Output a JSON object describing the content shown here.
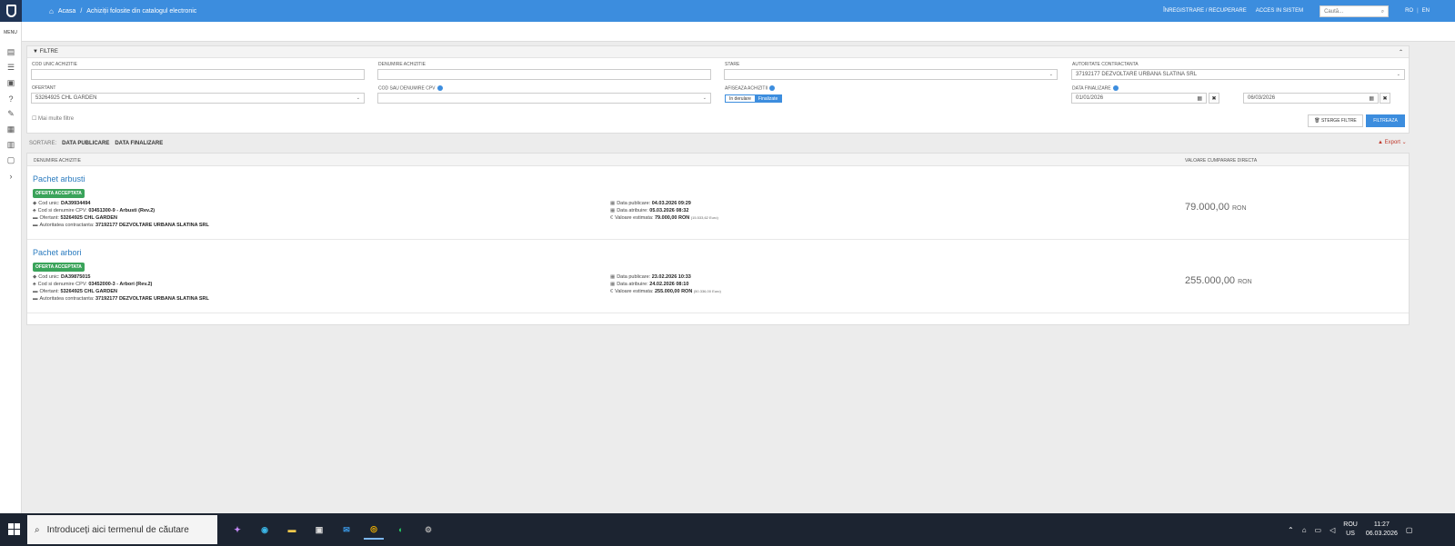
{
  "header": {
    "home_label": "Acasa",
    "separator": "/",
    "page_title": "Achiziții folosite din catalogul electronic",
    "register_link": "ÎNREGISTRARE / RECUPERARE",
    "login_link": "ACCES IN SISTEM",
    "search_placeholder": "Caută...",
    "lang_ro": "RO",
    "lang_sep": "|",
    "lang_en": "EN",
    "accent_color": "#3c8dde"
  },
  "sidebar": {
    "menu_label": "MENU",
    "icons": [
      "document-icon",
      "list-icon",
      "book-icon",
      "help-icon",
      "tools-icon",
      "id-card-icon",
      "layout-icon",
      "chat-icon"
    ]
  },
  "filters": {
    "title": "FILTRE",
    "cod_unic_label": "COD UNIC ACHIZITIE",
    "cod_unic_value": "",
    "denumire_label": "DENUMIRE ACHIZITIE",
    "denumire_value": "",
    "stare_label": "STARE",
    "stare_value": "",
    "autoritate_label": "AUTORITATE CONTRACTANTA",
    "autoritate_value": "37192177 DEZVOLTARE URBANA SLATINA SRL",
    "ofertant_label": "OFERTANT",
    "ofertant_value": "53264925 CHL GARDEN",
    "cpv_label": "COD SAU DENUMIRE CPV",
    "cpv_value": "",
    "afiseaza_label": "AFISEAZA ACHIZITII",
    "toggle_off": "In derulare",
    "toggle_on": "Finalizate",
    "data_finalizare_label": "DATA FINALIZARE",
    "date_from": "01/01/2026",
    "date_to": "06/03/2026",
    "more_filters": "Mai multe filtre",
    "clear_button": "STERGE FILTRE",
    "filter_button": "FILTREAZA"
  },
  "sorting": {
    "label": "SORTARE:",
    "options": [
      "DATA PUBLICARE",
      "DATA FINALIZARE"
    ],
    "export_label": "Export"
  },
  "results": {
    "col_name": "DENUMIRE ACHIZITIE",
    "col_value": "VALOARE CUMPARARE DIRECTA",
    "items": [
      {
        "title": "Pachet arbusti",
        "badge": "OFERTA ACCEPTATA",
        "cod_label": "Cod unic:",
        "cod": "DA39934494",
        "cpv_label": "Cod si denumire CPV:",
        "cpv": "03451300-9 - Arbusti (Rev.2)",
        "ofertant_label": "Ofertant:",
        "ofertant": "53264925 CHL GARDEN",
        "autoritate_label": "Autoritatea contractanta:",
        "autoritate": "37192177 DEZVOLTARE URBANA SLATINA SRL",
        "publicare_label": "Data publicare:",
        "publicare": "04.03.2026 09:29",
        "atribuire_label": "Data atribuire:",
        "atribuire": "05.03.2026 08:32",
        "estimata_label": "Valoare estimata:",
        "estimata": "79.000,00",
        "estimata_currency": "RON",
        "estimata_eur": "(15.533,62 Euro)",
        "value": "79.000,00",
        "currency": "RON"
      },
      {
        "title": "Pachet arbori",
        "badge": "OFERTA ACCEPTATA",
        "cod_label": "Cod unic:",
        "cod": "DA39875015",
        "cpv_label": "Cod si denumire CPV:",
        "cpv": "03452000-3 - Arbori (Rev.2)",
        "ofertant_label": "Ofertant:",
        "ofertant": "53264925 CHL GARDEN",
        "autoritate_label": "Autoritatea contractanta:",
        "autoritate": "37192177 DEZVOLTARE URBANA SLATINA SRL",
        "publicare_label": "Data publicare:",
        "publicare": "23.02.2026 10:33",
        "atribuire_label": "Data atribuire:",
        "atribuire": "24.02.2026 08:10",
        "estimata_label": "Valoare estimata:",
        "estimata": "255.000,00",
        "estimata_currency": "RON",
        "estimata_eur": "(50.336,00 Euro)",
        "value": "255.000,00",
        "currency": "RON"
      }
    ]
  },
  "taskbar": {
    "search_placeholder": "Introduceți aici termenul de căutare",
    "lang_top": "ROU",
    "lang_bottom": "US",
    "time": "11:27",
    "date": "06.03.2026"
  }
}
